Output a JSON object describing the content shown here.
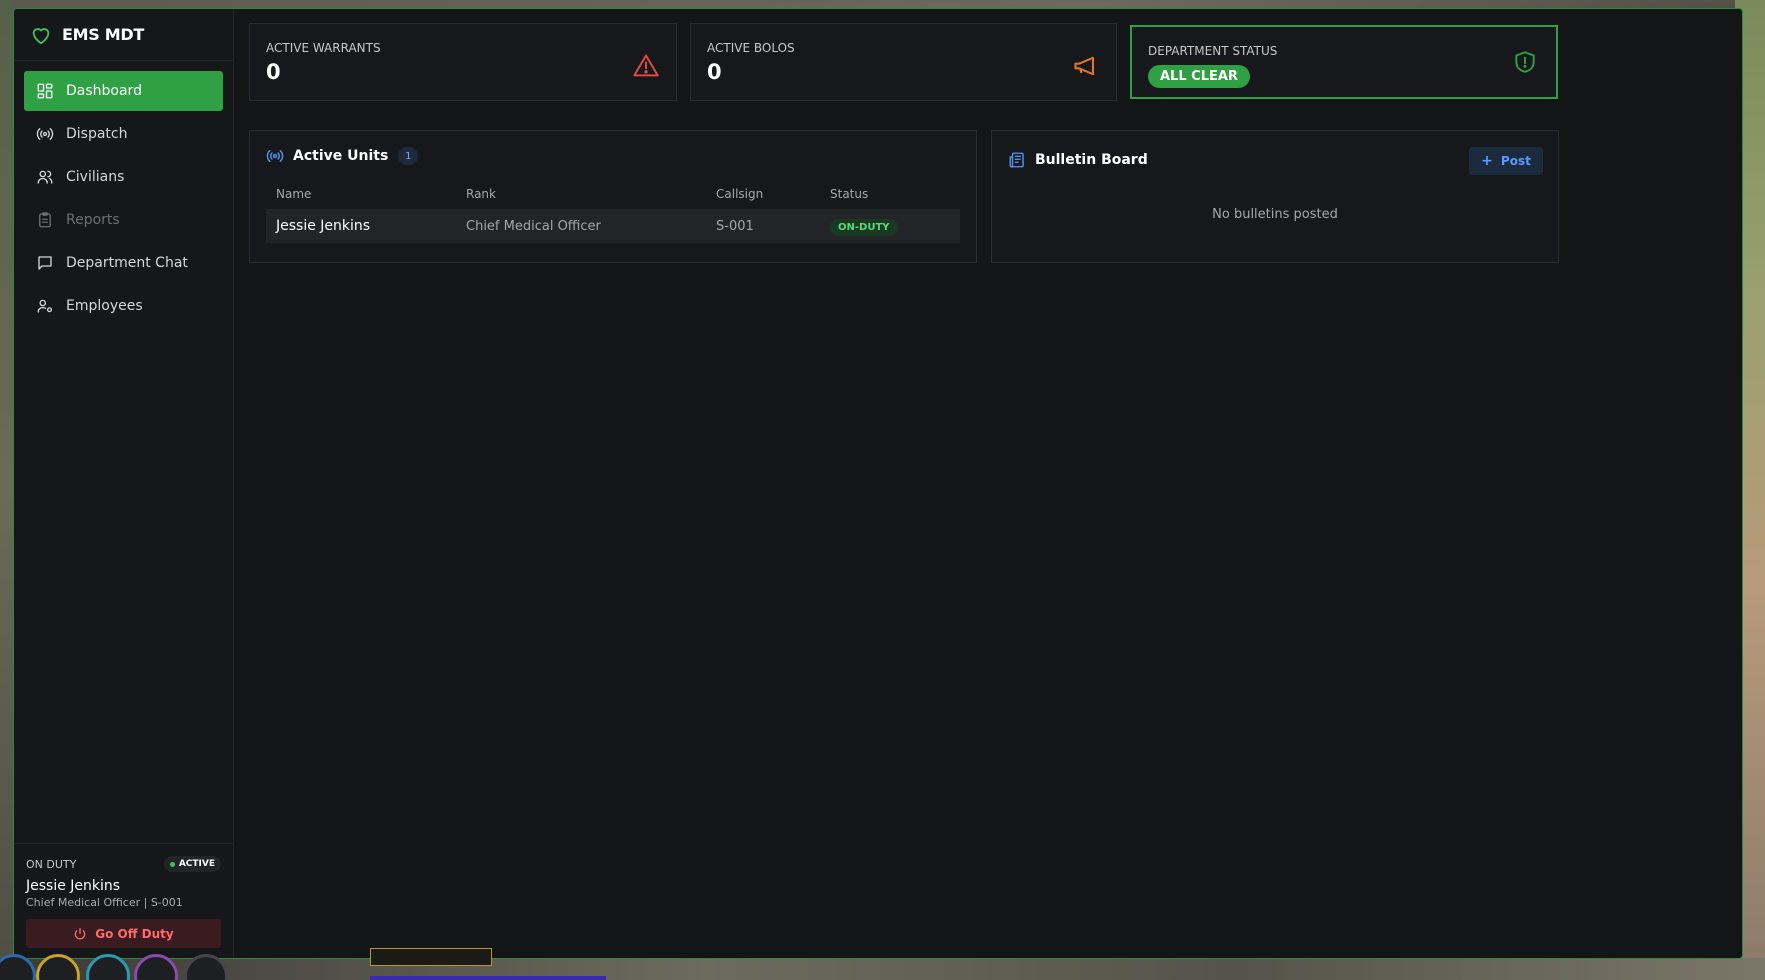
{
  "brand": {
    "title": "EMS MDT"
  },
  "sidebar": {
    "items": [
      {
        "label": "Dashboard",
        "icon": "grid-icon",
        "active": true
      },
      {
        "label": "Dispatch",
        "icon": "radio-icon"
      },
      {
        "label": "Civilians",
        "icon": "users-icon"
      },
      {
        "label": "Reports",
        "icon": "clipboard-icon",
        "disabled": true
      },
      {
        "label": "Department Chat",
        "icon": "chat-icon"
      },
      {
        "label": "Employees",
        "icon": "user-gear-icon"
      }
    ]
  },
  "duty": {
    "label": "ON DUTY",
    "badge": "ACTIVE",
    "name": "Jessie Jenkins",
    "subtitle": "Chief Medical Officer | S-001",
    "button": "Go Off Duty"
  },
  "stats": {
    "warrants": {
      "label": "ACTIVE WARRANTS",
      "value": "0"
    },
    "bolos": {
      "label": "ACTIVE BOLOS",
      "value": "0"
    },
    "department": {
      "label": "DEPARTMENT STATUS",
      "value": "ALL CLEAR"
    }
  },
  "units": {
    "title": "Active Units",
    "count": "1",
    "columns": [
      "Name",
      "Rank",
      "Callsign",
      "Status"
    ],
    "rows": [
      {
        "name": "Jessie Jenkins",
        "rank": "Chief Medical Officer",
        "callsign": "S-001",
        "status": "ON-DUTY"
      }
    ]
  },
  "bulletin": {
    "title": "Bulletin Board",
    "post_label": "Post",
    "empty": "No bulletins posted"
  },
  "colors": {
    "accent": "#2fa044",
    "danger": "#e04848",
    "warning": "#e0762a",
    "info": "#5a9bff"
  }
}
